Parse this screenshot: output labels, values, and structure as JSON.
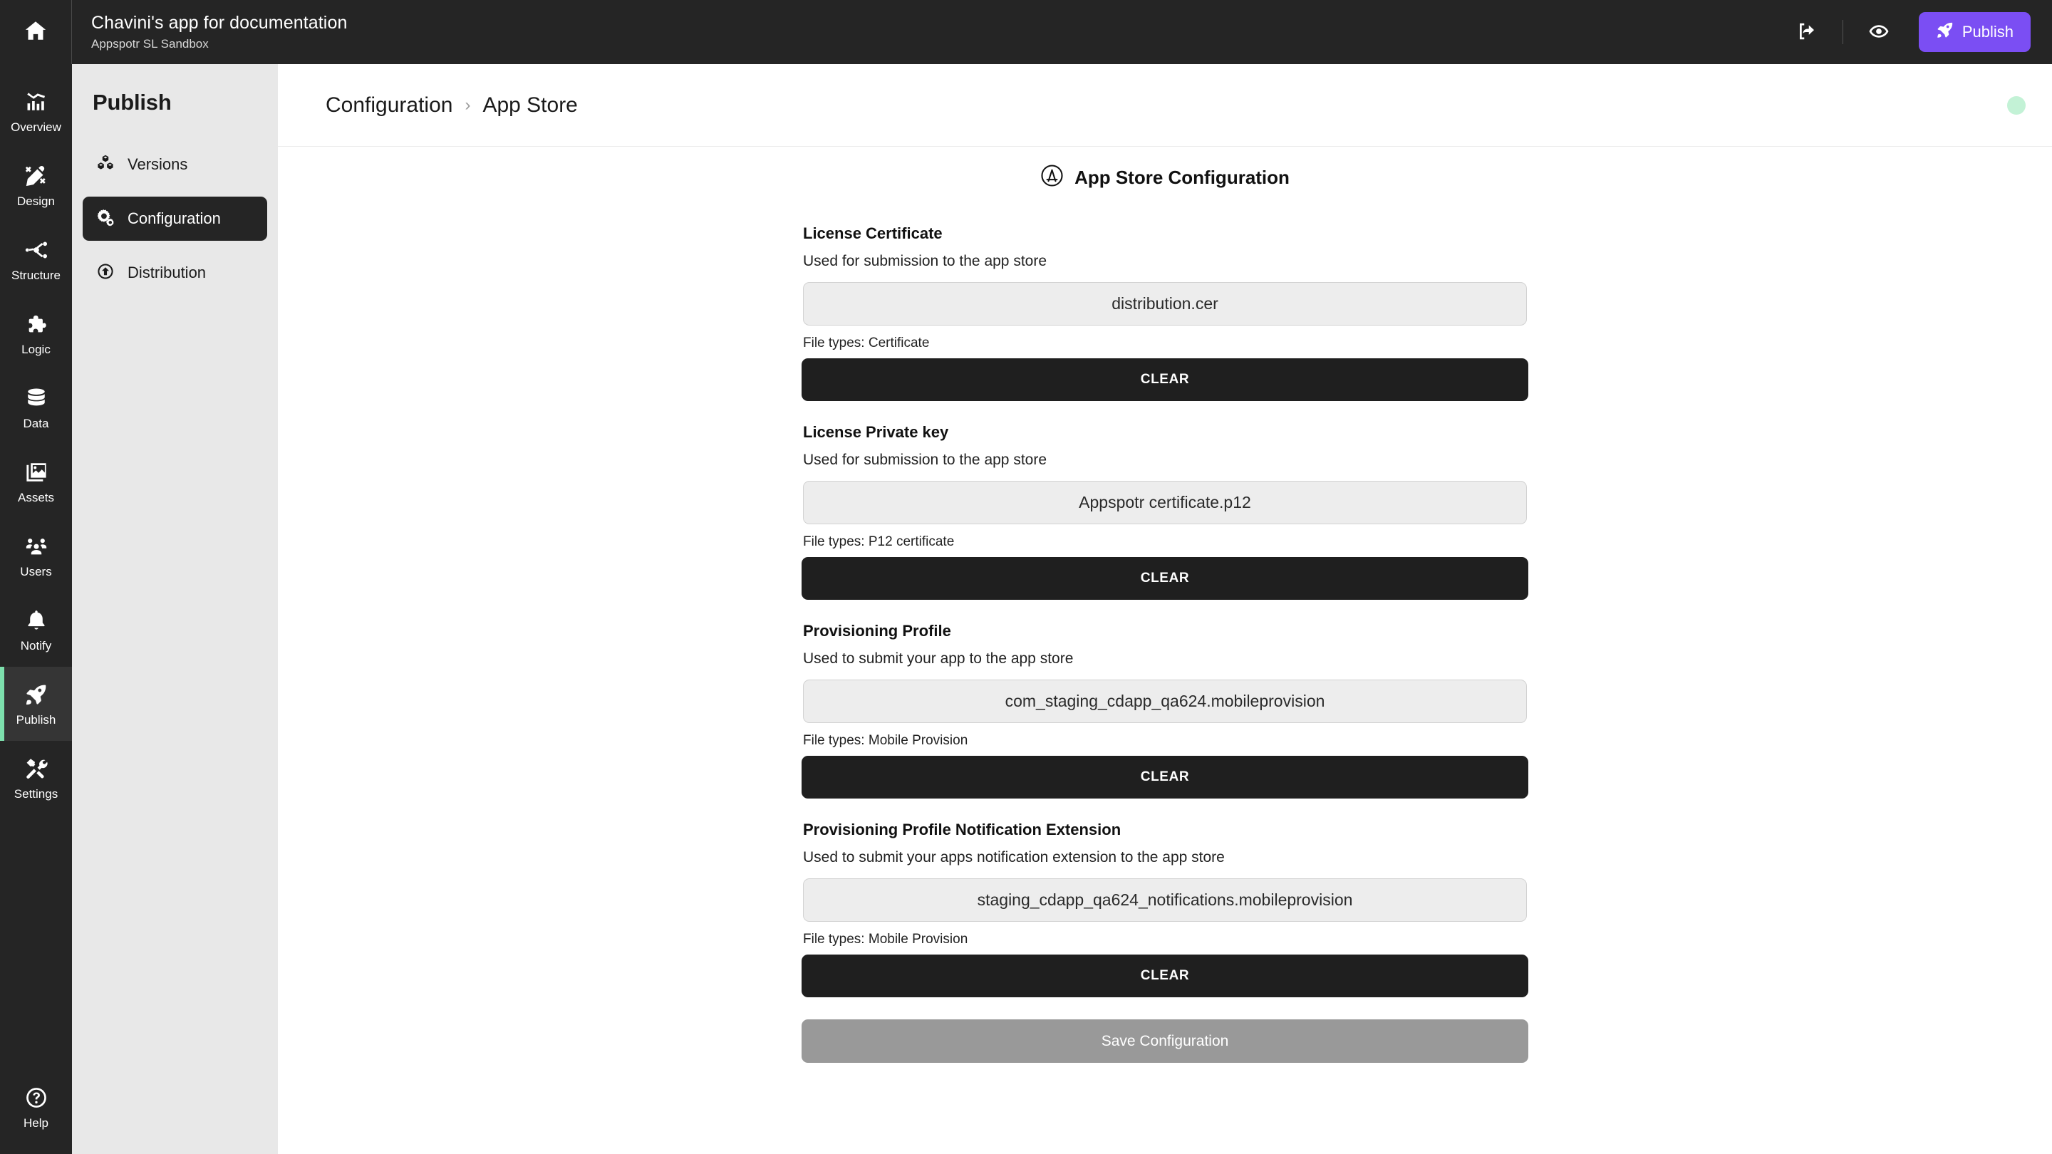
{
  "topbar": {
    "home_icon": "home-icon",
    "app_title": "Chavini's app for documentation",
    "workspace": "Appspotr SL Sandbox",
    "share_icon": "share-icon",
    "preview_icon": "eye-icon",
    "publish_label": "Publish",
    "publish_icon": "rocket-icon",
    "publish_color": "#7b4ef3"
  },
  "rail": {
    "items": [
      {
        "label": "Overview",
        "icon": "chart-icon",
        "active": false
      },
      {
        "label": "Design",
        "icon": "pencil-icon",
        "active": false
      },
      {
        "label": "Structure",
        "icon": "nodes-icon",
        "active": false
      },
      {
        "label": "Logic",
        "icon": "puzzle-icon",
        "active": false
      },
      {
        "label": "Data",
        "icon": "database-icon",
        "active": false
      },
      {
        "label": "Assets",
        "icon": "images-icon",
        "active": false
      },
      {
        "label": "Users",
        "icon": "users-icon",
        "active": false
      },
      {
        "label": "Notify",
        "icon": "bell-icon",
        "active": false
      },
      {
        "label": "Publish",
        "icon": "rocket-icon",
        "active": true
      },
      {
        "label": "Settings",
        "icon": "tools-icon",
        "active": false
      }
    ],
    "help": {
      "label": "Help",
      "icon": "question-circle-icon"
    },
    "active_accent": "#7de0ad"
  },
  "subnav": {
    "title": "Publish",
    "items": [
      {
        "label": "Versions",
        "icon": "cubes-icon",
        "active": false
      },
      {
        "label": "Configuration",
        "icon": "gears-icon",
        "active": true
      },
      {
        "label": "Distribution",
        "icon": "upload-circle-icon",
        "active": false
      }
    ]
  },
  "breadcrumb": {
    "parent": "Configuration",
    "separator": "›",
    "current": "App Store"
  },
  "status": {
    "dot_color": "#c3f2d6"
  },
  "section": {
    "icon": "app-store-icon",
    "title": "App Store Configuration"
  },
  "fields": [
    {
      "label": "License Certificate",
      "help": "Used for submission to the app store",
      "value": "distribution.cer",
      "file_types": "File types: Certificate",
      "clear_label": "CLEAR"
    },
    {
      "label": "License Private key",
      "help": "Used for submission to the app store",
      "value": "Appspotr certificate.p12",
      "file_types": "File types: P12 certificate",
      "clear_label": "CLEAR"
    },
    {
      "label": "Provisioning Profile",
      "help": "Used to submit your app to the app store",
      "value": "com_staging_cdapp_qa624.mobileprovision",
      "file_types": "File types: Mobile Provision",
      "clear_label": "CLEAR"
    },
    {
      "label": "Provisioning Profile Notification Extension",
      "help": "Used to submit your apps notification extension to the app store",
      "value": "staging_cdapp_qa624_notifications.mobileprovision",
      "file_types": "File types: Mobile Provision",
      "clear_label": "CLEAR"
    }
  ],
  "save": {
    "label": "Save Configuration",
    "color": "#999999"
  }
}
